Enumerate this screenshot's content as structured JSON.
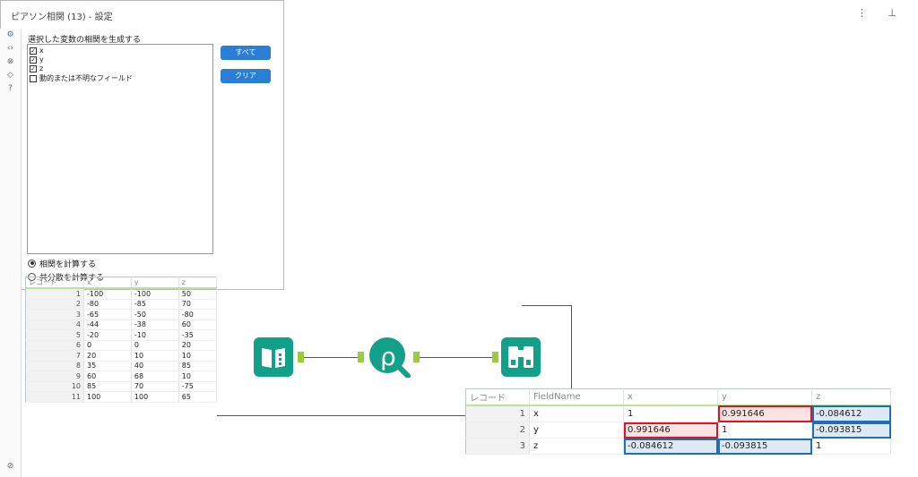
{
  "config": {
    "title": "ピアソン相関 (13) - 設定",
    "header_icons": "⋮ ⊥",
    "section_label": "選択した変数の相関を生成する",
    "fields": [
      {
        "label": "x",
        "checked": true
      },
      {
        "label": "y",
        "checked": true
      },
      {
        "label": "z",
        "checked": true
      },
      {
        "label": "動的または不明なフィールド",
        "checked": false
      }
    ],
    "select_all_button": "すべて",
    "clear_button": "クリア",
    "radio_options": [
      {
        "label": "相関を計算する",
        "selected": true
      },
      {
        "label": "共分散を計算する",
        "selected": false
      }
    ]
  },
  "input_table": {
    "headers": [
      "レコード",
      "x",
      "y",
      "z"
    ],
    "rows": [
      [
        "1",
        "-100",
        "-100",
        "50"
      ],
      [
        "2",
        "-80",
        "-85",
        "70"
      ],
      [
        "3",
        "-65",
        "-50",
        "-80"
      ],
      [
        "4",
        "-44",
        "-38",
        "60"
      ],
      [
        "5",
        "-20",
        "-10",
        "-35"
      ],
      [
        "6",
        "0",
        "0",
        "20"
      ],
      [
        "7",
        "20",
        "10",
        "10"
      ],
      [
        "8",
        "35",
        "40",
        "85"
      ],
      [
        "9",
        "60",
        "68",
        "10"
      ],
      [
        "10",
        "85",
        "70",
        "-75"
      ],
      [
        "11",
        "100",
        "100",
        "65"
      ]
    ]
  },
  "output_table": {
    "headers": [
      "レコード",
      "FieldName",
      "x",
      "y",
      "z"
    ],
    "rows": [
      [
        "1",
        "x",
        "1",
        "0.991646",
        "-0.084612"
      ],
      [
        "2",
        "y",
        "0.991646",
        "1",
        "-0.093815"
      ],
      [
        "3",
        "z",
        "-0.084612",
        "-0.093815",
        "1"
      ]
    ]
  },
  "colors": {
    "accent_blue": "#2a7ed6",
    "tool_teal": "#12a089",
    "highlight_red": "#e0141e",
    "highlight_blue": "#1d6fb8",
    "anchor_green": "#9ccc3a"
  },
  "icons": [
    "gear-icon",
    "code-icon",
    "x-circle-icon",
    "tag-icon",
    "help-icon",
    "check-circle-icon",
    "input-data-book-icon",
    "pearson-rho-icon",
    "browse-binoculars-icon"
  ]
}
